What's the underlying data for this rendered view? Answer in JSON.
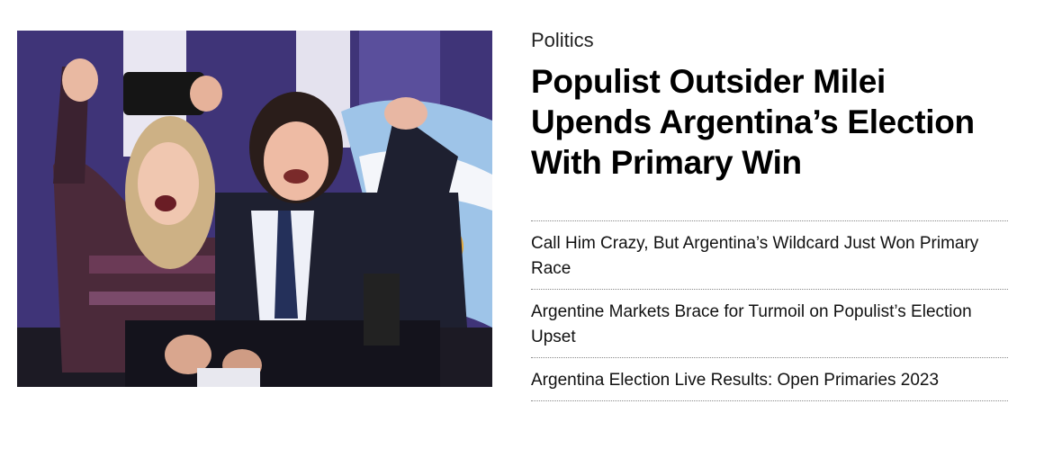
{
  "story": {
    "kicker": "Politics",
    "headline": "Populist Outsider Milei Upends Argentina’s Election With Primary Win"
  },
  "related": [
    {
      "title": "Call Him Crazy, But Argentina’s Wildcard Just Won Primary Race"
    },
    {
      "title": "Argentine Markets Brace for Turmoil on Populist’s Election Upset"
    },
    {
      "title": "Argentina Election Live Results: Open Primaries 2023"
    }
  ]
}
